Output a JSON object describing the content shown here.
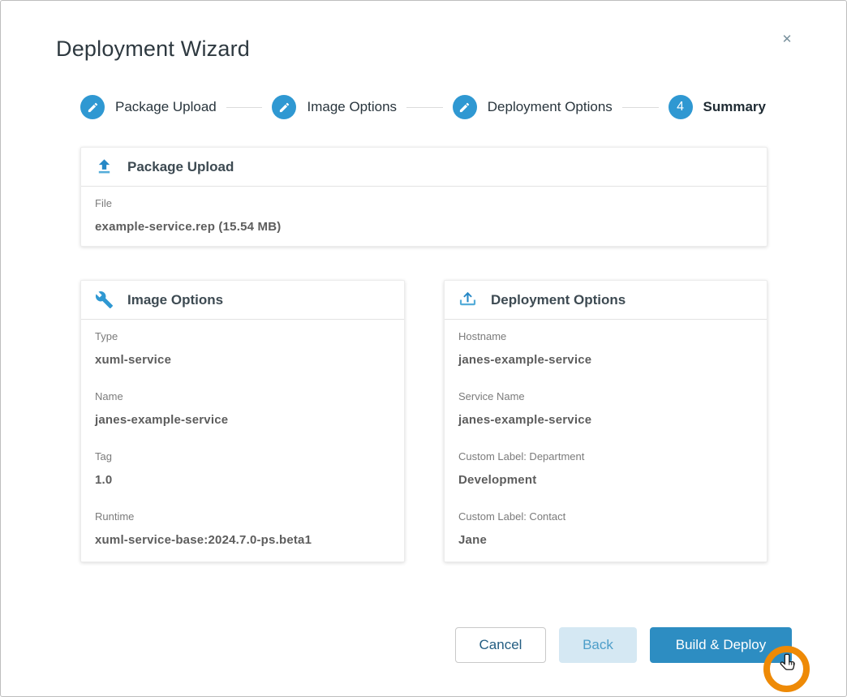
{
  "dialog": {
    "title": "Deployment Wizard",
    "close_glyph": "✕"
  },
  "stepper": {
    "steps": [
      {
        "label": "Package Upload",
        "icon": "pencil-icon",
        "active": false
      },
      {
        "label": "Image Options",
        "icon": "pencil-icon",
        "active": false
      },
      {
        "label": "Deployment Options",
        "icon": "pencil-icon",
        "active": false
      },
      {
        "label": "Summary",
        "number": "4",
        "active": true
      }
    ]
  },
  "cards": {
    "package_upload": {
      "title": "Package Upload",
      "icon": "upload-icon",
      "fields": [
        {
          "label": "File",
          "value": "example-service.rep (15.54 MB)"
        }
      ]
    },
    "image_options": {
      "title": "Image Options",
      "icon": "wrench-icon",
      "fields": [
        {
          "label": "Type",
          "value": "xuml-service"
        },
        {
          "label": "Name",
          "value": "janes-example-service"
        },
        {
          "label": "Tag",
          "value": "1.0"
        },
        {
          "label": "Runtime",
          "value": "xuml-service-base:2024.7.0-ps.beta1"
        }
      ]
    },
    "deployment_options": {
      "title": "Deployment Options",
      "icon": "tray-upload-icon",
      "fields": [
        {
          "label": "Hostname",
          "value": "janes-example-service"
        },
        {
          "label": "Service Name",
          "value": "janes-example-service"
        },
        {
          "label": "Custom Label: Department",
          "value": "Development"
        },
        {
          "label": "Custom Label: Contact",
          "value": "Jane"
        }
      ]
    }
  },
  "footer": {
    "cancel_label": "Cancel",
    "back_label": "Back",
    "build_deploy_label": "Build & Deploy"
  },
  "colors": {
    "primary_blue": "#2f98d2",
    "build_button_blue": "#2d8dc2",
    "back_button_bg": "#d5e8f3",
    "back_button_text": "#4d9ec9",
    "cursor_ring_orange": "#ee8a06"
  }
}
